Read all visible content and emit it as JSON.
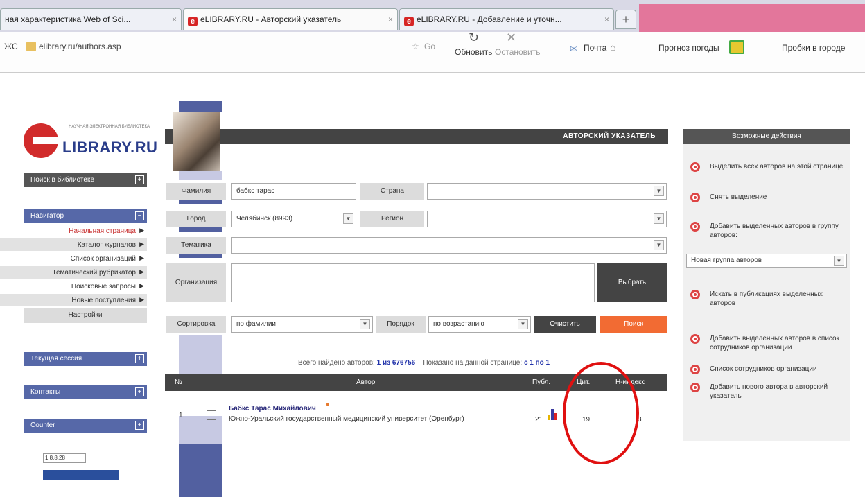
{
  "browser": {
    "tabs": [
      {
        "label": "ная характеристика Web of Sci..."
      },
      {
        "label": "eLIBRARY.RU - Авторский указатель"
      },
      {
        "label": "eLIBRARY.RU - Добавление и уточн..."
      }
    ],
    "tab_icon": "e",
    "new_tab": "+",
    "url_prefix": "ЖС",
    "url": "elibrary.ru/authors.asp",
    "go_label": "Go",
    "reload_label": "Обновить",
    "stop_label": "Остановить",
    "mail_label": "Почта",
    "weather_label": "Прогноз погоды",
    "traffic_label": "Пробки в городе"
  },
  "site": {
    "logo_small": "НАУЧНАЯ ЭЛЕКТРОННАЯ БИБЛИОТЕКА",
    "logo_big": "LIBRARY.RU",
    "left_menu": {
      "search": "Поиск в библиотеке",
      "navigator": "Навигатор",
      "nav_items": [
        "Начальная страница",
        "Каталог журналов",
        "Список организаций",
        "Тематический рубрикатор",
        "Поисковые запросы",
        "Новые поступления"
      ],
      "settings": "Настройки",
      "session": "Текущая сессия",
      "contacts": "Контакты",
      "counter": "Counter",
      "counter_value": "1.8.8.28"
    },
    "header_title": "АВТОРСКИЙ УКАЗАТЕЛЬ",
    "form": {
      "surname_label": "Фамилия",
      "surname_value": "бабкс тарас",
      "country_label": "Страна",
      "country_value": "",
      "city_label": "Город",
      "city_value": "Челябинск (8993)",
      "region_label": "Регион",
      "region_value": "",
      "topic_label": "Тематика",
      "org_label": "Организация",
      "choose_button": "Выбрать",
      "sort_label": "Сортировка",
      "sort_value": "по фамилии",
      "order_label": "Порядок",
      "order_value": "по возрастанию",
      "clear_button": "Очистить",
      "search_button": "Поиск"
    },
    "summary": {
      "found_prefix": "Всего найдено авторов:",
      "found": "1 из 676756",
      "shown_prefix": "Показано на данной странице:",
      "shown": "с 1 по 1"
    },
    "table": {
      "headers": [
        "№",
        "Автор",
        "Публ.",
        "Цит.",
        "Н-индекс"
      ],
      "rows": [
        {
          "num": "1",
          "name": "Бабкс Тарас Михайлович",
          "org": "Южно-Уральский государственный медицинский университет (Оренбург)",
          "pubs": "21",
          "cits": "19",
          "h": "3"
        }
      ]
    },
    "right_panel": {
      "title": "Возможные действия",
      "actions": [
        "Выделить всех авторов на этой странице",
        "Снять выделение",
        "Добавить выделенных авторов в группу авторов:",
        "Искать в публикациях выделенных авторов",
        "Добавить выделенных авторов в список сотрудников организации",
        "Список сотрудников организации",
        "Добавить нового автора в авторский указатель"
      ],
      "group_select": "Новая группа авторов"
    }
  },
  "colors": {
    "accent_blue": "#5260a0",
    "brand_red": "#d12b2b",
    "highlight_oval": "#e01010",
    "search_orange": "#f26b33"
  }
}
